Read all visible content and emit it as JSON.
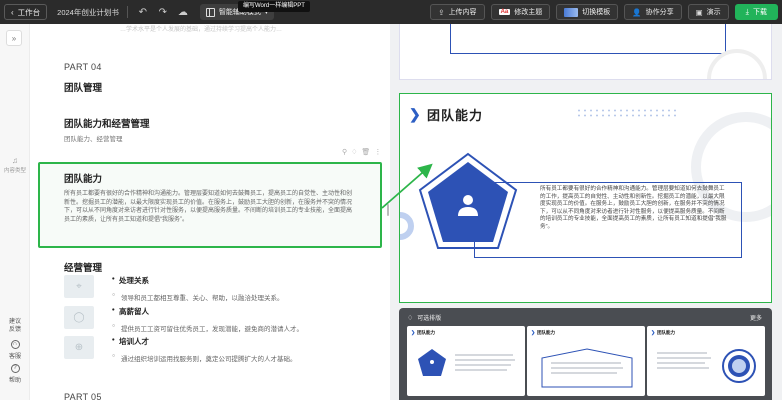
{
  "topbar": {
    "back_label": "工作台",
    "doc_name": "2024年创业计划书",
    "mode_label": "智能辅助模式",
    "tooltip": "编写Word一样编辑PPT",
    "buttons": {
      "upload": "上传内容",
      "theme": "修改主题",
      "template": "切换模板",
      "share": "协作分享",
      "present": "演示",
      "download": "下载"
    }
  },
  "left_rail": {
    "content_type": "内容类型",
    "feedback": "建议反馈",
    "support": "客服",
    "help": "帮助"
  },
  "outline": {
    "top_cut_text": "…学术水平是个人发展的基础，通过持续学习提高个人能力…",
    "part_label": "PART 04",
    "section_title": "团队管理",
    "item1_title": "团队能力和经营管理",
    "item1_sub": "团队能力、经营管理",
    "card": {
      "title": "团队能力",
      "body": "所有员工都要有很好的合作精神和沟通能力。管理层要知道如何去鼓舞员工，提高员工的自觉性、主动性和创新性。挖掘员工的潜能，以最大限度实现员工的价值。在服务上，鼓励员工大胆的创新，在服务并不突的情况下，可以从不同角度对来访者进行针对性服务，以便提高服务质量。不间断的培训员工的专业技能，全面提高员工的素质，让所有员工知道和提倡“我服务”。"
    },
    "item2_title": "经营管理",
    "sub_items": [
      {
        "title": "处理关系",
        "desc": "领导和员工都相互尊重、关心、帮助，以融洽处理关系。"
      },
      {
        "title": "高薪留人",
        "desc": "提供员工工资可留住优秀员工，发现潜能，避免商的潜请人才。"
      },
      {
        "title": "培训人才",
        "desc": "通过组织培训运用找服务则，奠定公司提腾扩大的人才基础。"
      }
    ],
    "next_part": "PART 05"
  },
  "preview": {
    "slide_title": "团队能力",
    "slide_body": "所有员工都要有很好的合作精神和沟通能力。管理层要知道如何去鼓舞员工的工作，提高员工的自觉性、主动性和创新性。挖掘员工的潜能，以最大限度实现员工的价值。在服务上，鼓励员工大胆的创新，在服务并不突的情况下，可以从不同角度对来访者进行针对性服务，以便提高服务质量。不间断的培训员工的专业技能，全面提高员工的素质，让所有员工知道和提倡“我服务”。",
    "recs_label": "可选排版",
    "recs_more": "更多",
    "rec_titles": [
      "团队能力",
      "团队能力",
      "团队能力"
    ]
  },
  "colors": {
    "accent_green": "#2db54a",
    "accent_blue": "#2d5fc4",
    "download_green": "#21b35a"
  }
}
